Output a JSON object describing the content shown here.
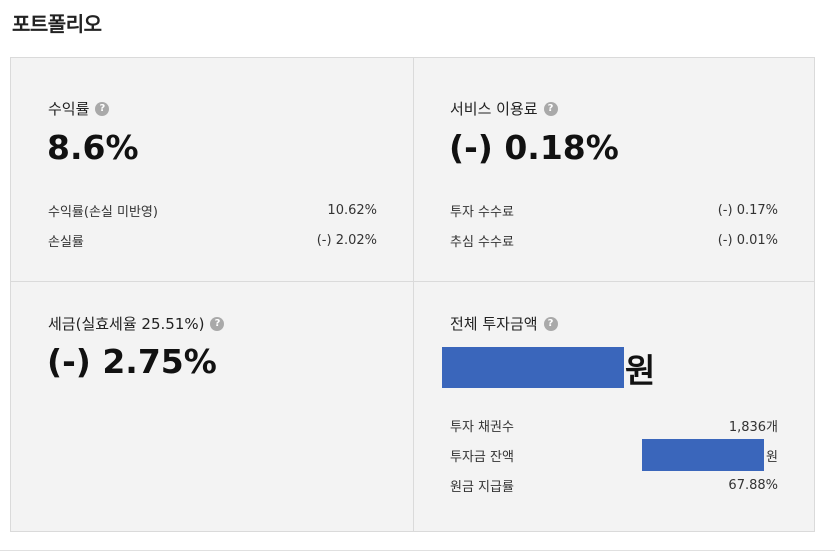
{
  "page": {
    "title": "포트폴리오"
  },
  "colors": {
    "panel_bg": "#f3f3f3",
    "border": "#dadada",
    "redaction": "#3a66bb",
    "help_icon": "#a9a9a9"
  },
  "icons": {
    "help": "question-circle-icon",
    "help_glyph": "?"
  },
  "cards": {
    "return_rate": {
      "label": "수익률",
      "value": "8.6%",
      "rows": [
        {
          "label": "수익률(손실 미반영)",
          "value": "10.62%"
        },
        {
          "label": "손실률",
          "value": "(-) 2.02%"
        }
      ]
    },
    "service_fee": {
      "label": "서비스 이용료",
      "value": "(-) 0.18%",
      "rows": [
        {
          "label": "투자 수수료",
          "value": "(-) 0.17%"
        },
        {
          "label": "추심 수수료",
          "value": "(-) 0.01%"
        }
      ]
    },
    "tax": {
      "label": "세금(실효세율 25.51%)",
      "value": "(-) 2.75%"
    },
    "total_investment": {
      "label": "전체 투자금액",
      "value_unit": "원",
      "rows": [
        {
          "label": "투자 채권수",
          "value": "1,836개"
        },
        {
          "label": "투자금 잔액",
          "value_unit": "원"
        },
        {
          "label": "원금 지급률",
          "value": "67.88%"
        }
      ]
    }
  }
}
